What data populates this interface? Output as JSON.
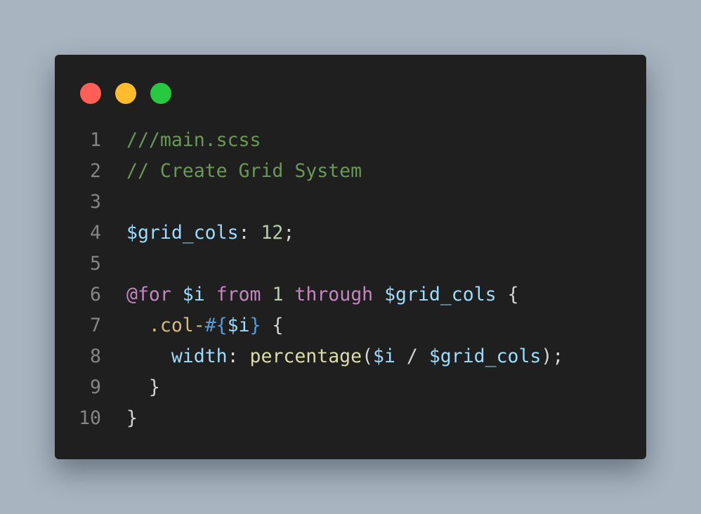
{
  "window_controls": {
    "close_color": "#ff5f57",
    "minimize_color": "#febc2e",
    "maximize_color": "#28c840"
  },
  "code": {
    "language": "scss",
    "lines": [
      {
        "number": "1",
        "tokens": [
          {
            "text": "///main.scss",
            "type": "comment"
          }
        ]
      },
      {
        "number": "2",
        "tokens": [
          {
            "text": "// Create Grid System",
            "type": "comment"
          }
        ]
      },
      {
        "number": "3",
        "tokens": []
      },
      {
        "number": "4",
        "tokens": [
          {
            "text": "$grid_cols",
            "type": "var"
          },
          {
            "text": ": ",
            "type": "punct"
          },
          {
            "text": "12",
            "type": "num"
          },
          {
            "text": ";",
            "type": "punct"
          }
        ]
      },
      {
        "number": "5",
        "tokens": []
      },
      {
        "number": "6",
        "tokens": [
          {
            "text": "@for",
            "type": "kw"
          },
          {
            "text": " ",
            "type": "punct"
          },
          {
            "text": "$i",
            "type": "var"
          },
          {
            "text": " ",
            "type": "punct"
          },
          {
            "text": "from",
            "type": "kw"
          },
          {
            "text": " ",
            "type": "punct"
          },
          {
            "text": "1",
            "type": "num"
          },
          {
            "text": " ",
            "type": "punct"
          },
          {
            "text": "through",
            "type": "kw"
          },
          {
            "text": " ",
            "type": "punct"
          },
          {
            "text": "$grid_cols",
            "type": "var"
          },
          {
            "text": " {",
            "type": "punct"
          }
        ]
      },
      {
        "number": "7",
        "tokens": [
          {
            "text": "  .col-",
            "type": "selector"
          },
          {
            "text": "#{",
            "type": "interp"
          },
          {
            "text": "$i",
            "type": "var"
          },
          {
            "text": "}",
            "type": "interp"
          },
          {
            "text": " {",
            "type": "punct"
          }
        ]
      },
      {
        "number": "8",
        "tokens": [
          {
            "text": "    ",
            "type": "punct"
          },
          {
            "text": "width",
            "type": "prop"
          },
          {
            "text": ": ",
            "type": "punct"
          },
          {
            "text": "percentage",
            "type": "fn"
          },
          {
            "text": "(",
            "type": "punct"
          },
          {
            "text": "$i",
            "type": "var"
          },
          {
            "text": " / ",
            "type": "punct"
          },
          {
            "text": "$grid_cols",
            "type": "var"
          },
          {
            "text": ");",
            "type": "punct"
          }
        ]
      },
      {
        "number": "9",
        "tokens": [
          {
            "text": "  }",
            "type": "punct"
          }
        ]
      },
      {
        "number": "10",
        "tokens": [
          {
            "text": "}",
            "type": "punct"
          }
        ]
      }
    ]
  }
}
